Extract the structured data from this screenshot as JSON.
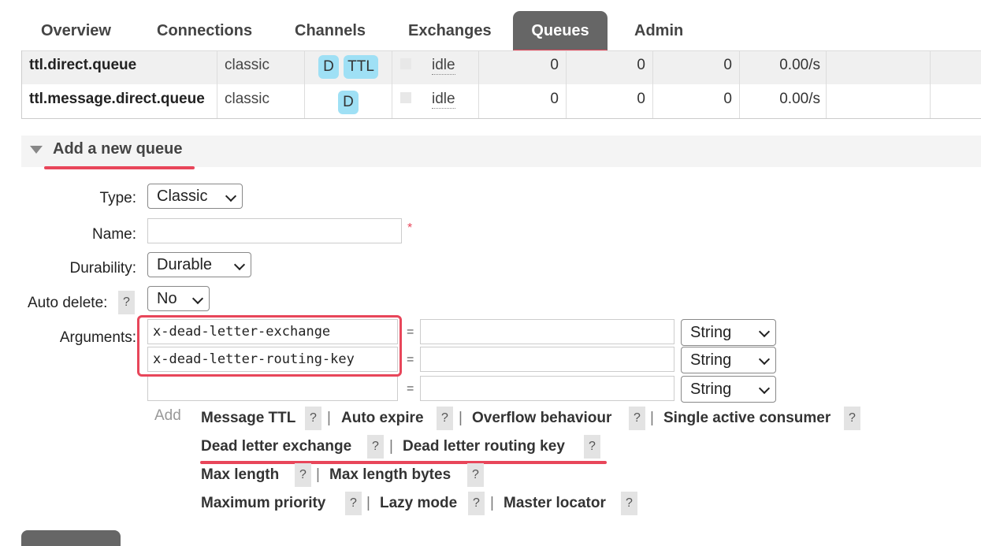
{
  "tabs": [
    {
      "label": "Overview"
    },
    {
      "label": "Connections"
    },
    {
      "label": "Channels"
    },
    {
      "label": "Exchanges"
    },
    {
      "label": "Queues",
      "active": true
    },
    {
      "label": "Admin"
    }
  ],
  "queues": [
    {
      "name": "ttl.direct.queue",
      "type": "classic",
      "features": [
        "D",
        "TTL"
      ],
      "state": "idle",
      "ready": "0",
      "unacked": "0",
      "total": "0",
      "rate": "0.00/s"
    },
    {
      "name": "ttl.message.direct.queue",
      "type": "classic",
      "features": [
        "D"
      ],
      "state": "idle",
      "ready": "0",
      "unacked": "0",
      "total": "0",
      "rate": "0.00/s"
    }
  ],
  "add_queue": {
    "title": "Add a new queue",
    "type_label": "Type:",
    "type_value": "Classic",
    "name_label": "Name:",
    "name_value": "",
    "required_mark": "*",
    "durability_label": "Durability:",
    "durability_value": "Durable",
    "auto_delete_label": "Auto delete:",
    "auto_delete_value": "No",
    "help_mark": "?",
    "arguments_label": "Arguments:",
    "equals": "=",
    "arguments": [
      {
        "key": "x-dead-letter-exchange",
        "value": "",
        "type": "String"
      },
      {
        "key": "x-dead-letter-routing-key",
        "value": "",
        "type": "String"
      },
      {
        "key": "",
        "value": "",
        "type": "String"
      }
    ],
    "add_label": "Add",
    "shortcuts": {
      "message_ttl": "Message TTL",
      "auto_expire": "Auto expire",
      "overflow_behaviour": "Overflow behaviour",
      "single_active_consumer": "Single active consumer",
      "dead_letter_exchange": "Dead letter exchange",
      "dead_letter_routing_key": "Dead letter routing key",
      "max_length": "Max length",
      "max_length_bytes": "Max length bytes",
      "maximum_priority": "Maximum priority",
      "lazy_mode": "Lazy mode",
      "master_locator": "Master locator"
    },
    "separator": "|"
  },
  "colors": {
    "accent_red": "#e8465a",
    "badge_blue": "#9fe0f5",
    "tab_active": "#666666"
  }
}
